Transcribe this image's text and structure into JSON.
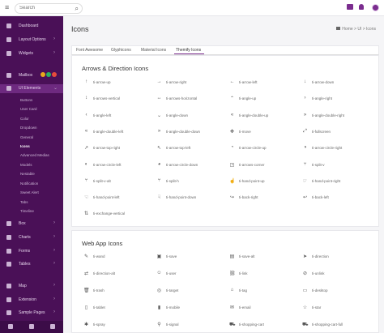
{
  "topbar": {
    "menu_icon": "hamburger-icon",
    "search_placeholder": "Search",
    "icons": [
      "mail-icon",
      "bell-icon",
      "avatar"
    ]
  },
  "sidebar": {
    "items": [
      {
        "label": "Dashboard",
        "icon": "dashboard-icon"
      },
      {
        "label": "Layout Options",
        "icon": "layout-icon"
      },
      {
        "label": "Widgets",
        "icon": "widgets-icon"
      },
      {
        "label": "Mailbox",
        "icon": "mail-icon"
      },
      {
        "label": "UI Elements",
        "icon": "ui-icon"
      },
      {
        "label": "Box",
        "icon": "box-icon"
      },
      {
        "label": "Charts",
        "icon": "charts-icon"
      },
      {
        "label": "Forms",
        "icon": "forms-icon"
      },
      {
        "label": "Tables",
        "icon": "tables-icon"
      },
      {
        "label": "Map",
        "icon": "map-icon"
      },
      {
        "label": "Extension",
        "icon": "extension-icon"
      },
      {
        "label": "Sample Pages",
        "icon": "pages-icon"
      }
    ],
    "sub_items": [
      "Buttons",
      "User Card",
      "Color",
      "Dropdown",
      "General",
      "Icons",
      "Advanced Medias",
      "Models",
      "Nestable",
      "Notification",
      "Sweet Alert",
      "Tabs",
      "Timeline"
    ],
    "active_sub": "Icons",
    "badge_colors": [
      "#e9a91c",
      "#28b463",
      "#e74c3c"
    ]
  },
  "page": {
    "title": "Icons",
    "breadcrumb": [
      "Home",
      "UI",
      "Icons"
    ]
  },
  "tabs": [
    "Font Awesome",
    "Glyphicons",
    "Material Icons",
    "Themify Icons"
  ],
  "active_tab": "Themify Icons",
  "sections": [
    {
      "title": "Arrows & Direction Icons",
      "icons": [
        {
          "g": "↑",
          "n": "ti-arrow-up"
        },
        {
          "g": "→",
          "n": "ti-arrow-right"
        },
        {
          "g": "←",
          "n": "ti-arrow-left"
        },
        {
          "g": "↓",
          "n": "ti-arrow-down"
        },
        {
          "g": "↕",
          "n": "ti-arrows-vertical"
        },
        {
          "g": "↔",
          "n": "ti-arrows-horizontal"
        },
        {
          "g": "⌃",
          "n": "ti-angle-up"
        },
        {
          "g": "›",
          "n": "ti-angle-right"
        },
        {
          "g": "‹",
          "n": "ti-angle-left"
        },
        {
          "g": "⌄",
          "n": "ti-angle-down"
        },
        {
          "g": "«",
          "n": "ti-angle-double-up"
        },
        {
          "g": "»",
          "n": "ti-angle-double-right"
        },
        {
          "g": "«",
          "n": "ti-angle-double-left"
        },
        {
          "g": "»",
          "n": "ti-angle-double-down"
        },
        {
          "g": "✥",
          "n": "ti-move"
        },
        {
          "g": "⤢",
          "n": "ti-fullscreen"
        },
        {
          "g": "↗",
          "n": "ti-arrow-top-right"
        },
        {
          "g": "↖",
          "n": "ti-arrow-top-left"
        },
        {
          "g": "◔",
          "n": "ti-arrow-circle-up"
        },
        {
          "g": "◑",
          "n": "ti-arrow-circle-right"
        },
        {
          "g": "◐",
          "n": "ti-arrow-circle-left"
        },
        {
          "g": "◕",
          "n": "ti-arrow-circle-down"
        },
        {
          "g": "◳",
          "n": "ti-arrows-corner"
        },
        {
          "g": "⑂",
          "n": "ti-split-v"
        },
        {
          "g": "⑂",
          "n": "ti-split-v-alt"
        },
        {
          "g": "⑂",
          "n": "ti-split-h"
        },
        {
          "g": "☝",
          "n": "ti-hand-point-up"
        },
        {
          "g": "☞",
          "n": "ti-hand-point-right"
        },
        {
          "g": "☜",
          "n": "ti-hand-point-left"
        },
        {
          "g": "☟",
          "n": "ti-hand-point-down"
        },
        {
          "g": "↪",
          "n": "ti-back-right"
        },
        {
          "g": "↩",
          "n": "ti-back-left"
        },
        {
          "g": "⇅",
          "n": "ti-exchange-vertical"
        }
      ]
    },
    {
      "title": "Web App Icons",
      "icons": [
        {
          "g": "✎",
          "n": "ti-wand"
        },
        {
          "g": "▣",
          "n": "ti-save"
        },
        {
          "g": "▤",
          "n": "ti-save-alt"
        },
        {
          "g": "➤",
          "n": "ti-direction"
        },
        {
          "g": "⇄",
          "n": "ti-direction-alt"
        },
        {
          "g": "☺",
          "n": "ti-user"
        },
        {
          "g": "⛓",
          "n": "ti-link"
        },
        {
          "g": "⊘",
          "n": "ti-unlink"
        },
        {
          "g": "🗑",
          "n": "ti-trash"
        },
        {
          "g": "◎",
          "n": "ti-target"
        },
        {
          "g": "⌂",
          "n": "ti-tag"
        },
        {
          "g": "▭",
          "n": "ti-desktop"
        },
        {
          "g": "▯",
          "n": "ti-tablet"
        },
        {
          "g": "▮",
          "n": "ti-mobile"
        },
        {
          "g": "✉",
          "n": "ti-email"
        },
        {
          "g": "☆",
          "n": "ti-star"
        },
        {
          "g": "✱",
          "n": "ti-spray"
        },
        {
          "g": "⚲",
          "n": "ti-signal"
        },
        {
          "g": "⛟",
          "n": "ti-shopping-cart"
        },
        {
          "g": "⛟",
          "n": "ti-shopping-cart-full"
        }
      ]
    }
  ]
}
